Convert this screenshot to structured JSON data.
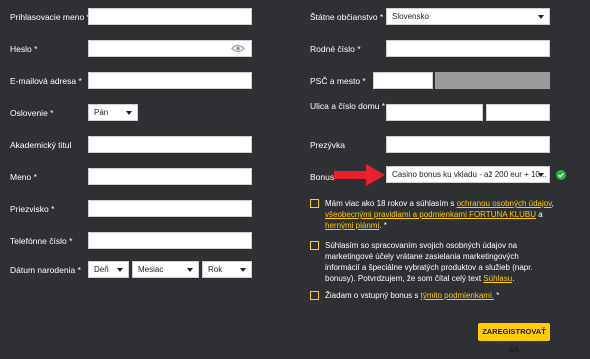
{
  "left": {
    "username_label": "Prihlasovacie meno *",
    "password_label": "Heslo *",
    "email_label": "E-mailová adresa *",
    "salutation_label": "Oslovenie *",
    "salutation_value": "Pán",
    "title_label": "Akademický titul",
    "firstname_label": "Meno *",
    "lastname_label": "Priezvisko *",
    "phone_label": "Telefónne číslo *",
    "birthdate_label": "Dátum narodenia *",
    "day_value": "Deň",
    "month_value": "Mesiac",
    "year_value": "Rok"
  },
  "right": {
    "citizenship_label": "Štátne občianstvo *",
    "citizenship_value": "Slovensko",
    "birthnumber_label": "Rodné číslo *",
    "zip_city_label": "PSČ a mesto *",
    "street_label": "Ulica a číslo domu *",
    "nickname_label": "Prezývka",
    "bonus_label": "Bonus *",
    "bonus_value": "Casino bonus ku vkladu - až 200 eur + 10..."
  },
  "consents": {
    "c1_pre": "Mám viac ako 18 rokov a súhlasím s ",
    "c1_link1": "ochranou osobných údajov",
    "c1_mid1": ", ",
    "c1_link2": "všeobecnými pravidlami a podmienkami FORTUNA KLUBU",
    "c1_mid2": " a ",
    "c1_link3": "hernými plánmi",
    "c1_post": ". *",
    "c2_pre": "Súhlasím so spracovaním svojich osobných údajov na marketingové účely vrátane zasielania marketingových informácií a špeciálne vybratých produktov a služieb (napr. bonusy). Potvrdzujem, že som čítal celý text ",
    "c2_link": "Súhlasu",
    "c2_post": ".",
    "c3_pre": "Žiadam o vstupný bonus s ",
    "c3_link": "týmito podmienkami.",
    "c3_post": " *"
  },
  "register_button": "ZAREGISTROVAŤ SA",
  "colors": {
    "accent": "#ffcc00",
    "background": "#2f3033",
    "arrow": "#e8202a",
    "ok": "#2db34a"
  },
  "icons": {
    "password_toggle": "eye-icon",
    "bonus_pointer": "red-arrow-icon",
    "bonus_valid": "check-circle-icon"
  }
}
